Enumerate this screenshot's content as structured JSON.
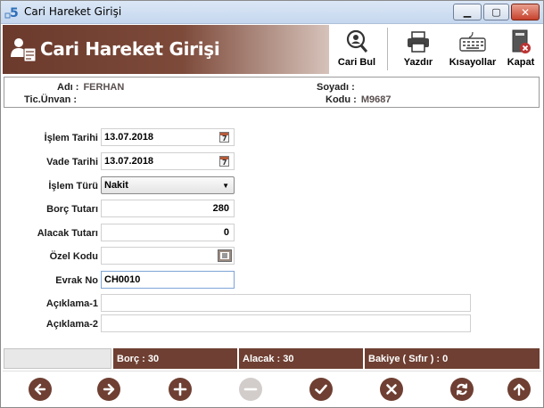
{
  "window": {
    "title": "Cari Hareket Girişi"
  },
  "header": {
    "title": "Cari Hareket Girişi",
    "tools": [
      {
        "label": "Cari Bul",
        "icon": "search-person-icon"
      },
      {
        "label": "Yazdır",
        "icon": "printer-icon"
      },
      {
        "label": "Kısayollar",
        "icon": "keyboard-icon"
      },
      {
        "label": "Kapat",
        "icon": "close-document-icon"
      }
    ]
  },
  "info": {
    "adi_label": "Adı :",
    "adi_value": "FERHAN",
    "unvan_label": "Tic.Ünvan :",
    "unvan_value": "",
    "soyadi_label": "Soyadı :",
    "soyadi_value": "",
    "kodu_label": "Kodu :",
    "kodu_value": "M9687"
  },
  "form": {
    "islem_tarihi": {
      "label": "İşlem Tarihi",
      "value": "13.07.2018"
    },
    "vade_tarihi": {
      "label": "Vade Tarihi",
      "value": "13.07.2018"
    },
    "islem_turu": {
      "label": "İşlem Türü",
      "value": "Nakit"
    },
    "borc_tutari": {
      "label": "Borç Tutarı",
      "value": "280"
    },
    "alacak_tutari": {
      "label": "Alacak Tutarı",
      "value": "0"
    },
    "ozel_kodu": {
      "label": "Özel Kodu",
      "value": ""
    },
    "evrak_no": {
      "label": "Evrak No",
      "value": "CH0010"
    },
    "aciklama1": {
      "label": "Açıklama-1",
      "value": ""
    },
    "aciklama2": {
      "label": "Açıklama-2",
      "value": ""
    }
  },
  "summary": {
    "borc": "Borç : 30",
    "alacak": "Alacak : 30",
    "bakiye": "Bakiye ( Sıfır       ) : 0"
  },
  "colors": {
    "accent": "#6e3f32",
    "disabled": "#d2cdcb"
  },
  "footer": {
    "buttons": [
      "prev-icon",
      "next-icon",
      "add-icon",
      "remove-icon",
      "confirm-icon",
      "cancel-icon",
      "refresh-icon",
      "up-icon"
    ]
  }
}
